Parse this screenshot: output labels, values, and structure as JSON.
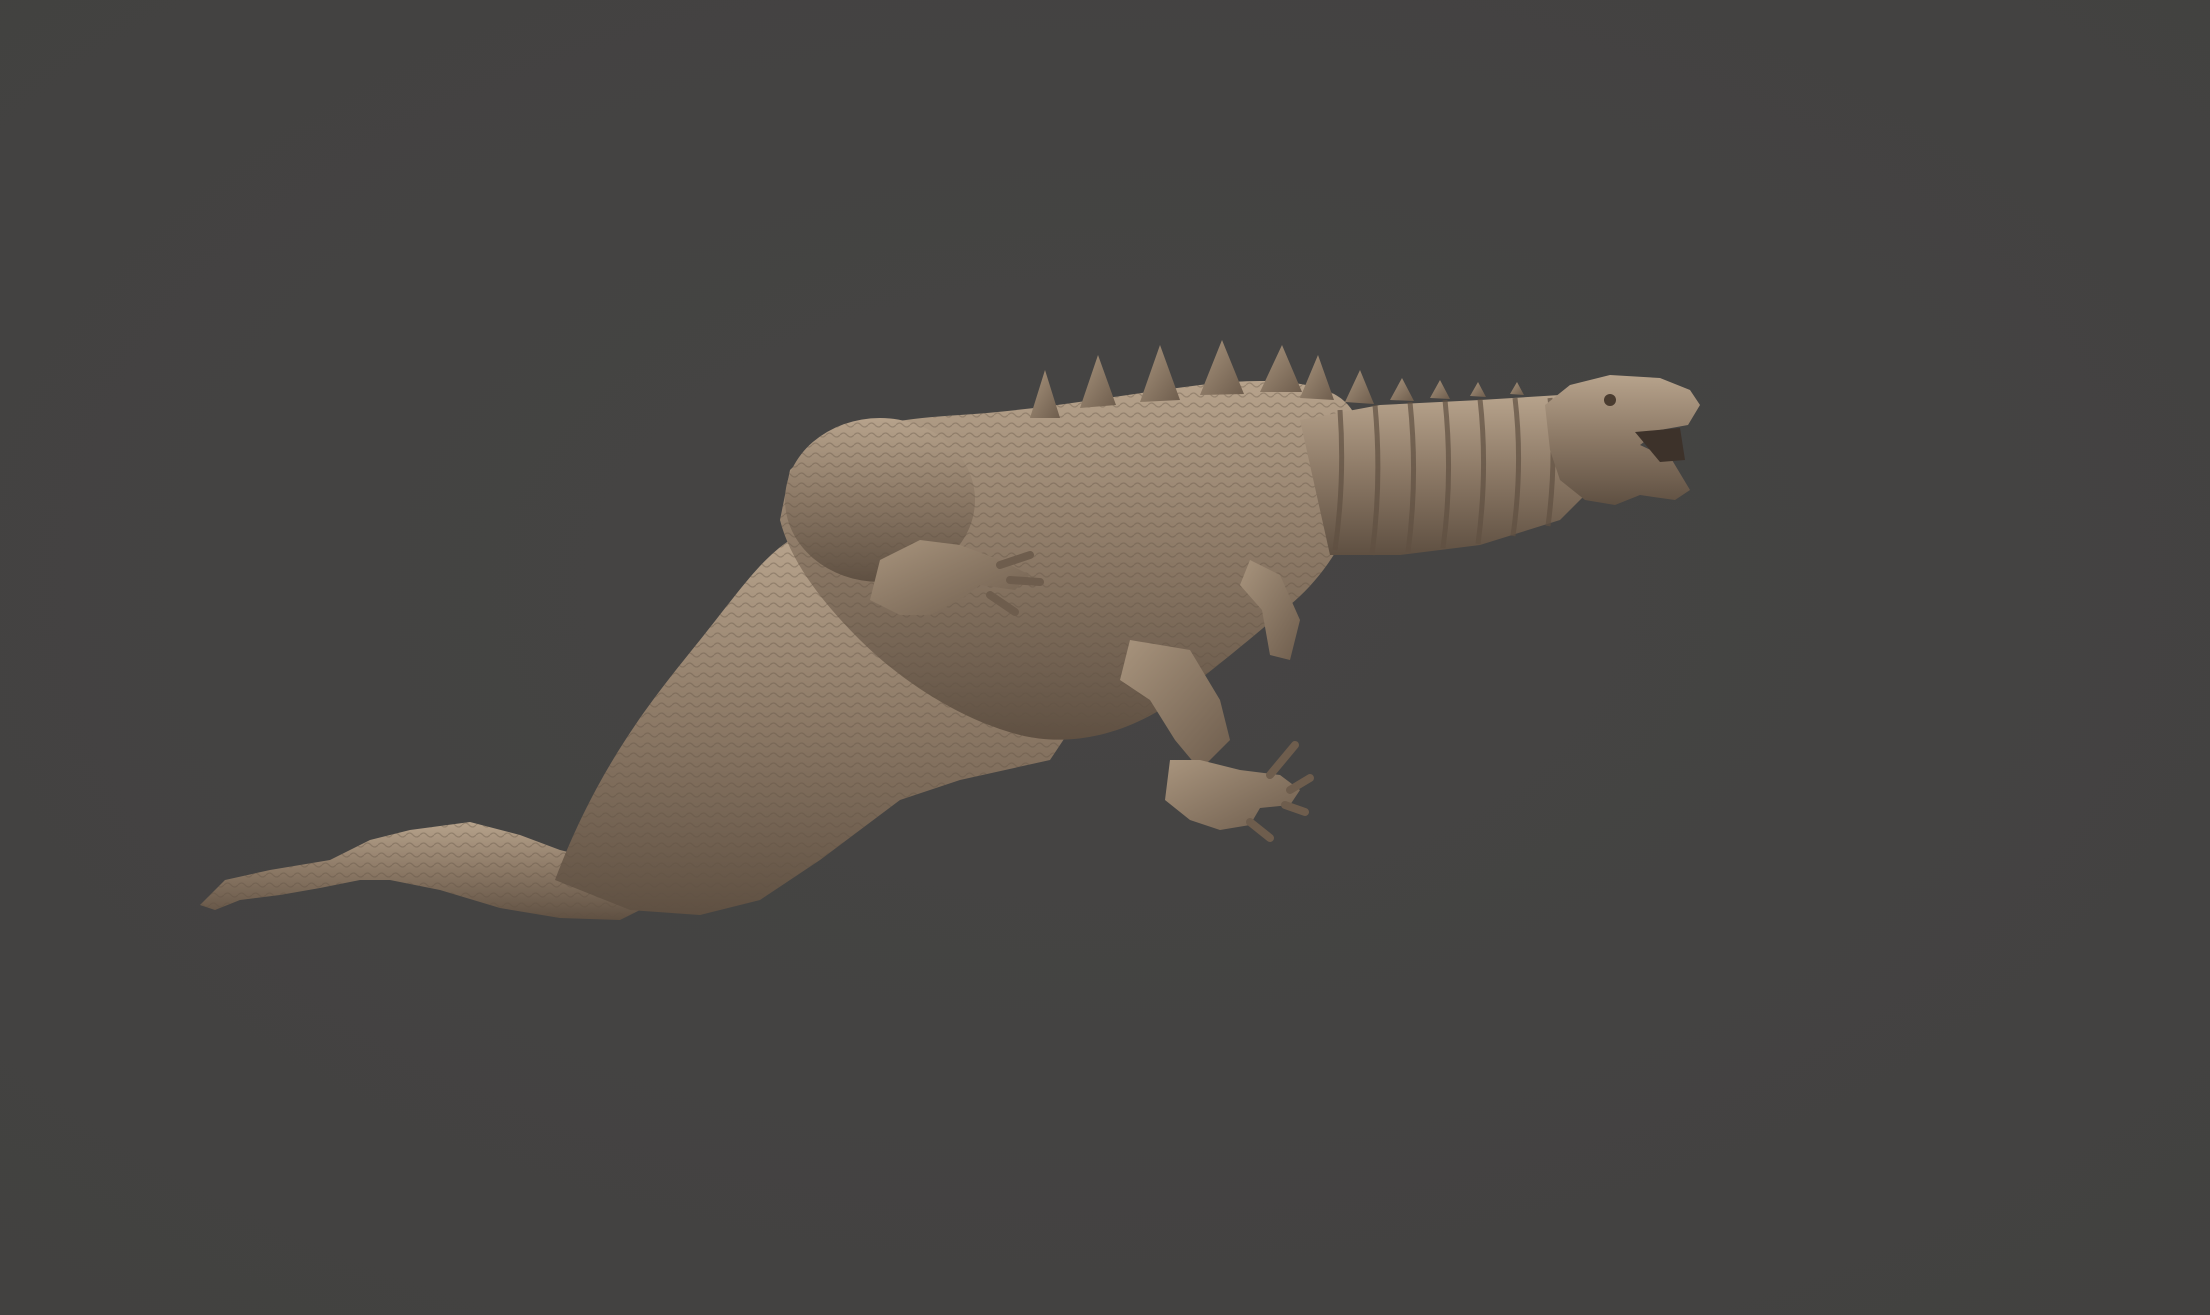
{
  "viewport": {
    "background_color": "#424140",
    "background_color_center": "#464544"
  },
  "model": {
    "subject": "kaiju-creature-sculpt",
    "material_color": "#8b7865",
    "highlight_color": "#b7a38c",
    "shadow_color": "#5f5042"
  }
}
